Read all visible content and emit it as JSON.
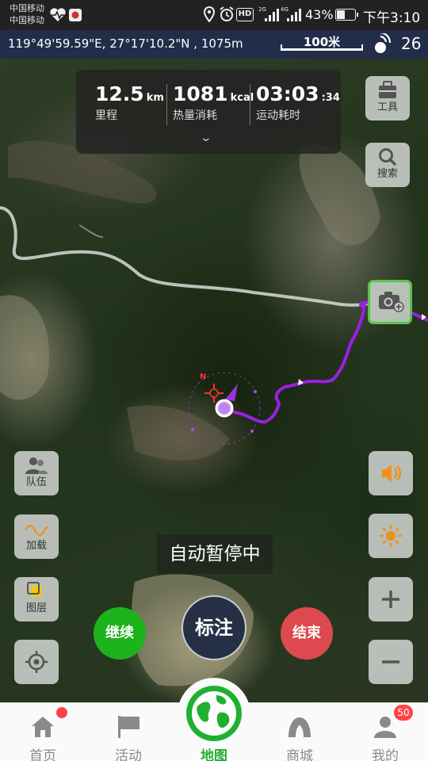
{
  "status_bar": {
    "carrier_1": "中国移动",
    "carrier_2": "中国移动",
    "hd": "HD",
    "net_1": "2G",
    "net_2": "4G",
    "battery": "43%",
    "battery_level": 0.43,
    "time": "下午3:10"
  },
  "coord_bar": {
    "coordinates": "119°49'59.59\"E, 27°17'10.2\"N , 1075m",
    "scale": "100米",
    "satellites": "26"
  },
  "stats": {
    "distance_value": "12.5",
    "distance_unit": "km",
    "distance_label": "里程",
    "calories_value": "1081",
    "calories_unit": "kcal",
    "calories_label": "热量消耗",
    "time_value": "03:03",
    "time_seconds": ":34",
    "time_label": "运动耗时"
  },
  "right_buttons": {
    "tools": "工具",
    "search": "搜索"
  },
  "left_buttons": {
    "team": "队伍",
    "load": "加载",
    "layers": "图层"
  },
  "compass_label": "N",
  "map_status": "自动暂停中",
  "actions": {
    "continue": "继续",
    "mark": "标注",
    "end": "结束"
  },
  "nav": {
    "home": "首页",
    "activity": "活动",
    "map": "地图",
    "store": "商城",
    "mine": "我的",
    "mine_badge": "50"
  },
  "colors": {
    "track": "#9b1fe0",
    "accent_green": "#20b030",
    "end_red": "#dc4a4f",
    "sound_orange": "#f0901a",
    "coord_bar_bg": "#222d4a"
  }
}
